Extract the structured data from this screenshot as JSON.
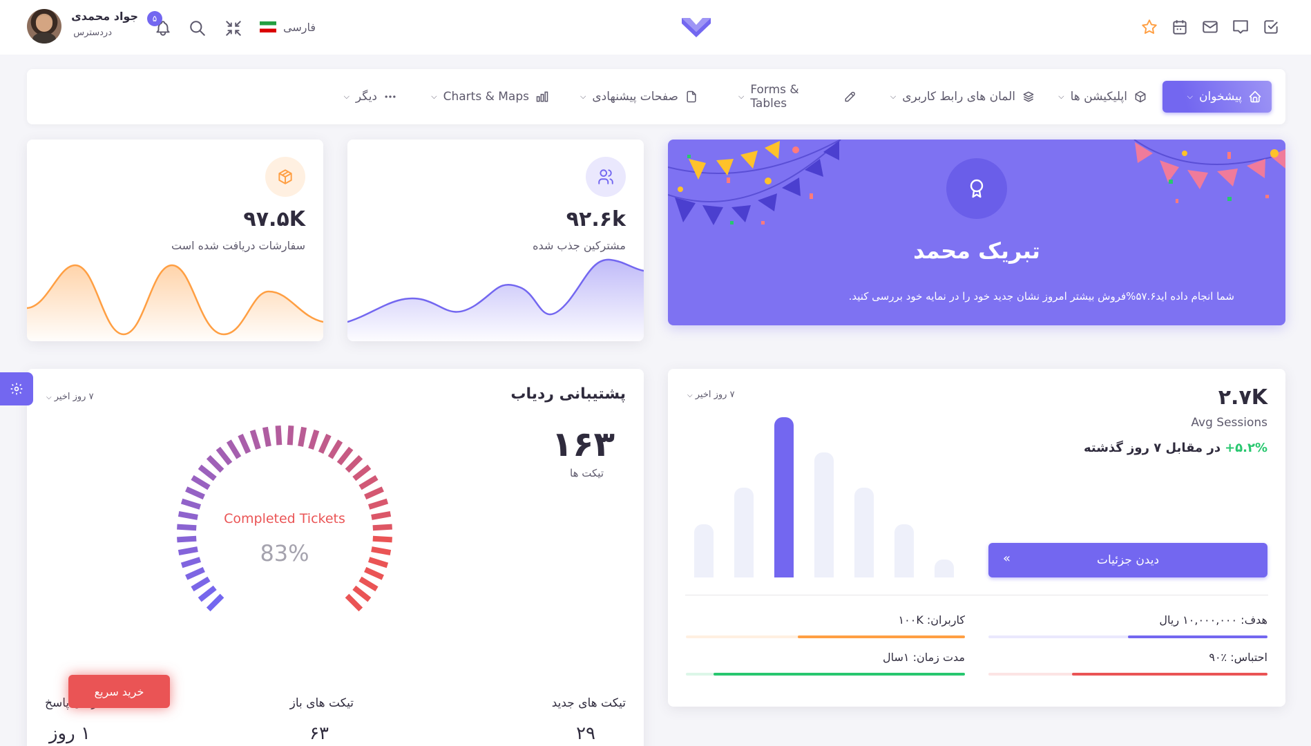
{
  "user": {
    "name": "جواد محمدی",
    "status": "دردسترس",
    "notif_count": "۵"
  },
  "language": {
    "label": "فارسی"
  },
  "nav": {
    "items": [
      {
        "label": "پیشخوان",
        "icon": "home-icon",
        "active": true
      },
      {
        "label": "اپلیکیشن ها",
        "icon": "box-icon"
      },
      {
        "label": "المان های رابط کاربری",
        "icon": "layers-icon"
      },
      {
        "label": "Forms & Tables",
        "icon": "pencil-icon"
      },
      {
        "label": "صفحات پیشنهادی",
        "icon": "file-icon"
      },
      {
        "label": "Charts & Maps",
        "icon": "chart-icon"
      },
      {
        "label": "دیگر",
        "icon": "dots-icon"
      }
    ]
  },
  "congrats": {
    "title": "تبریک محمد",
    "text": "شما انجام داده اید۵۷.۶%فروش بیشتر امروز نشان جدید خود را در نمایه خود بررسی کنید."
  },
  "customers": {
    "value": "۹۲.۶k",
    "label": "مشترکین جذب شده"
  },
  "orders": {
    "value": "۹۷.۵K",
    "label": "سفارشات دریافت شده است"
  },
  "sessions": {
    "value": "۲.۷K",
    "label": "Avg Sessions",
    "change": "+۵.۲%",
    "change_text": "در مقابل ۷ روز گذشته",
    "range": "۷ روز اخیر",
    "button": "دیدن جزئیات",
    "bars": [
      0.33,
      0.56,
      1.0,
      0.78,
      0.56,
      0.33,
      0.11
    ],
    "stats": [
      {
        "label": "هدف: ۱۰,۰۰۰,۰۰۰ ریال",
        "progress": 0.5,
        "color": "#7367f0",
        "track": "#eae8fd"
      },
      {
        "label": "کاربران: ۱۰۰K",
        "progress": 0.6,
        "color": "#ff9f43",
        "track": "#fff0e1"
      },
      {
        "label": "احتباس: ٪۹۰",
        "progress": 0.7,
        "color": "#ea5455",
        "track": "#fce4e4"
      },
      {
        "label": "مدت زمان: ۱سال",
        "progress": 0.9,
        "color": "#28c76f",
        "track": "#dcf6e8"
      }
    ]
  },
  "support": {
    "title": "پشتیبانی ردیاب",
    "range": "۷ روز اخیر",
    "total": "۱۶۳",
    "total_label": "تیکت ها",
    "gauge_label": "Completed Tickets",
    "gauge_value": "83%",
    "gauge_percent": 0.83,
    "stats": [
      {
        "label": "تیکت های جدید",
        "value": "۲۹"
      },
      {
        "label": "تیکت های باز",
        "value": "۶۳"
      },
      {
        "label": "زمان پاسخ",
        "value": "۱ روز"
      }
    ]
  },
  "buy_button": "خرید سریع",
  "colors": {
    "primary": "#7367f0",
    "warning": "#ff9f43",
    "danger": "#ea5455",
    "success": "#28c76f"
  }
}
